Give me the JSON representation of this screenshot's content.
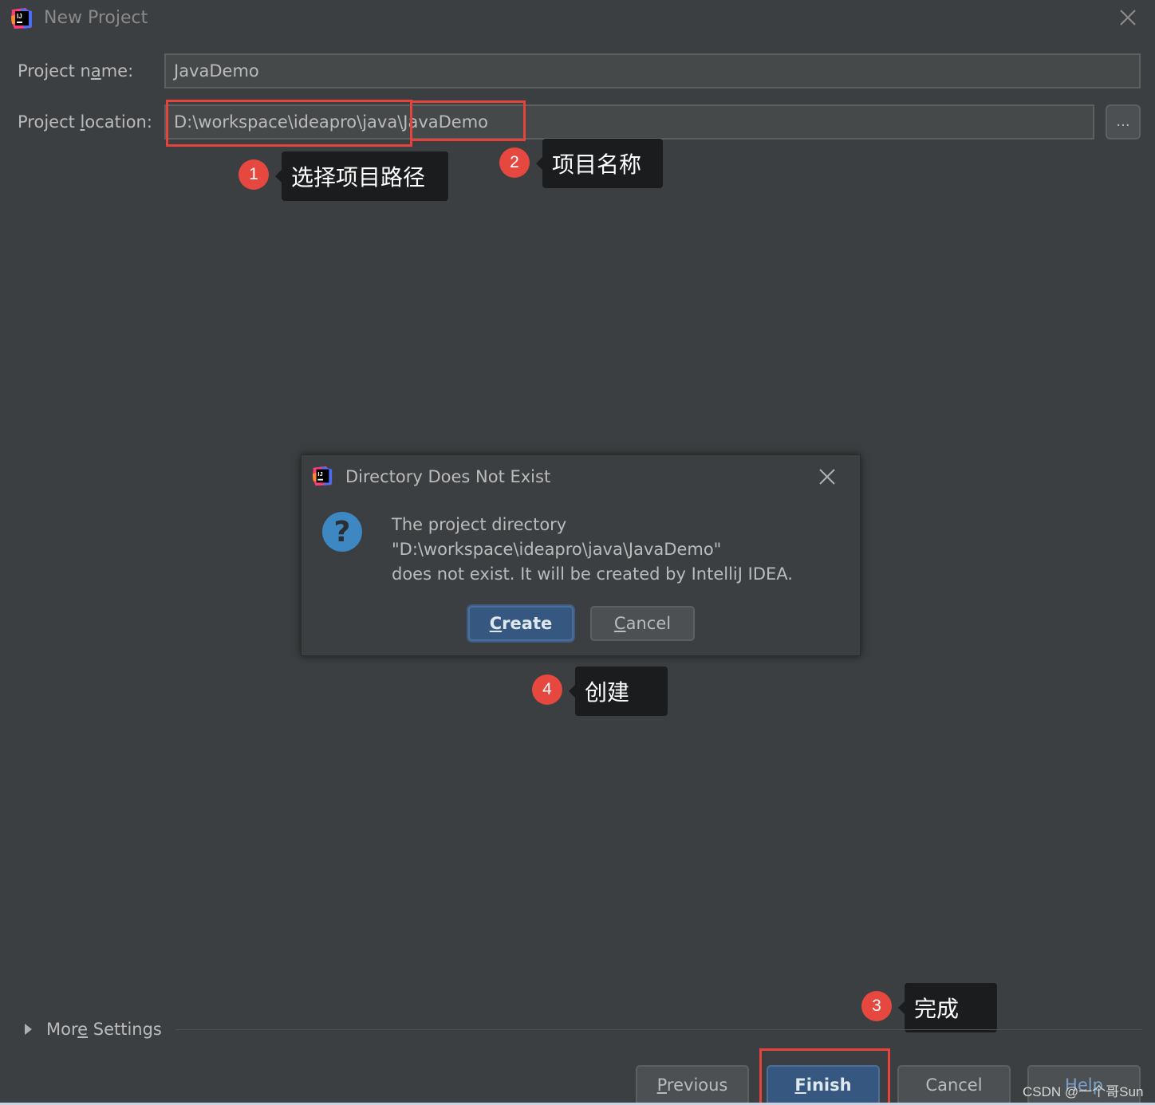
{
  "window": {
    "title": "New Project",
    "icon": "intellij-idea-icon",
    "close_icon": "close-icon"
  },
  "form": {
    "project_name": {
      "label_prefix": "Project n",
      "label_mnemonic": "a",
      "label_suffix": "me:",
      "value": "JavaDemo"
    },
    "project_location": {
      "label_prefix": "Project ",
      "label_mnemonic": "l",
      "label_suffix": "ocation:",
      "value": "D:\\workspace\\ideapro\\java\\JavaDemo",
      "browse_label": "..."
    }
  },
  "annotations": [
    {
      "number": "1",
      "text": "选择项目路径"
    },
    {
      "number": "2",
      "text": "项目名称"
    },
    {
      "number": "3",
      "text": "完成"
    },
    {
      "number": "4",
      "text": "创建"
    }
  ],
  "dialog": {
    "title": "Directory Does Not Exist",
    "icon": "question-icon",
    "message_lines": [
      "The project directory",
      "\"D:\\workspace\\ideapro\\java\\JavaDemo\"",
      "does not exist. It will be created by IntelliJ IDEA."
    ],
    "create_button": {
      "mnemonic": "C",
      "rest": "reate"
    },
    "cancel_button": {
      "mnemonic": "C",
      "rest": "ancel"
    }
  },
  "more_settings": {
    "prefix": "Mor",
    "mnemonic": "e",
    "suffix": " Settings"
  },
  "footer": {
    "previous": {
      "mnemonic": "P",
      "rest": "revious"
    },
    "finish": {
      "mnemonic": "F",
      "rest": "inish"
    },
    "cancel": "Cancel",
    "help": "Help"
  },
  "watermark": "CSDN @一个哥Sun",
  "colors": {
    "background": "#3c3f41",
    "field": "#45494a",
    "default_button": "#365880",
    "highlight": "#e5433b",
    "badge": "#e64840",
    "tooltip": "#1b1c1e"
  }
}
